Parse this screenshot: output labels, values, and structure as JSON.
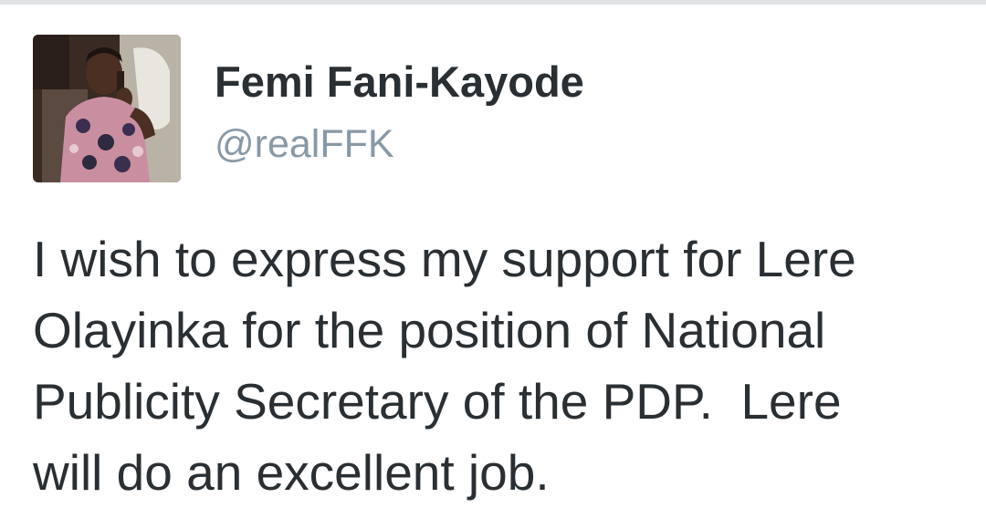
{
  "tweet": {
    "author": {
      "display_name": "Femi Fani-Kayode",
      "handle": "@realFFK",
      "avatar_icon": "profile-photo"
    },
    "text_lines": [
      "I wish to express my support for Lere",
      "Olayinka for the position of National",
      "Publicity Secretary of the PDP.  Lere",
      "will do an excellent job."
    ]
  },
  "colors": {
    "name": "#292f33",
    "handle": "#8899a6",
    "text": "#292f33",
    "divider": "#e1e3e5"
  }
}
